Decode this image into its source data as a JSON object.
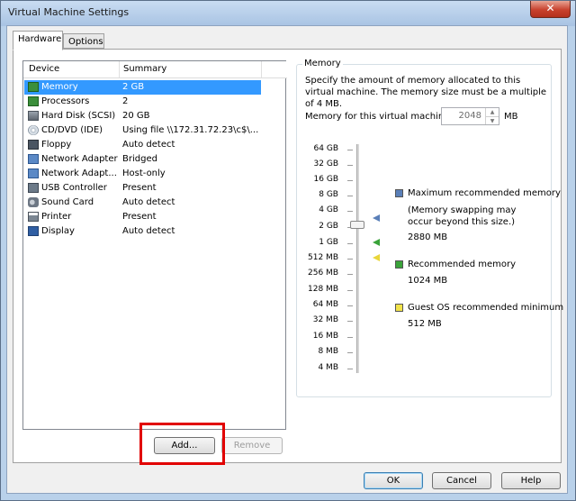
{
  "window": {
    "title": "Virtual Machine Settings",
    "close_glyph": "✕"
  },
  "tabs": [
    {
      "label": "Hardware",
      "active": true
    },
    {
      "label": "Options",
      "active": false
    }
  ],
  "device_list": {
    "columns": [
      "Device",
      "Summary"
    ],
    "rows": [
      {
        "icon": "memory-chip-icon",
        "device": "Memory",
        "summary": "2 GB",
        "selected": true
      },
      {
        "icon": "processor-chip-icon",
        "device": "Processors",
        "summary": "2"
      },
      {
        "icon": "hard-disk-icon",
        "device": "Hard Disk (SCSI)",
        "summary": "20 GB"
      },
      {
        "icon": "cd-dvd-icon",
        "device": "CD/DVD (IDE)",
        "summary": "Using file \\\\172.31.72.23\\c$\\..."
      },
      {
        "icon": "floppy-icon",
        "device": "Floppy",
        "summary": "Auto detect"
      },
      {
        "icon": "network-adapter-icon",
        "device": "Network Adapter",
        "summary": "Bridged"
      },
      {
        "icon": "network-adapter-icon",
        "device": "Network Adapt...",
        "summary": "Host-only"
      },
      {
        "icon": "usb-icon",
        "device": "USB Controller",
        "summary": "Present"
      },
      {
        "icon": "sound-card-icon",
        "device": "Sound Card",
        "summary": "Auto detect"
      },
      {
        "icon": "printer-icon",
        "device": "Printer",
        "summary": "Present"
      },
      {
        "icon": "display-icon",
        "device": "Display",
        "summary": "Auto detect"
      }
    ]
  },
  "list_buttons": {
    "add": "Add...",
    "remove": "Remove"
  },
  "memory": {
    "group_title": "Memory",
    "description": "Specify the amount of memory allocated to this virtual machine. The memory size must be a multiple of 4 MB.",
    "field_label": "Memory for this virtual machine:",
    "field_value": "2048",
    "unit": "MB",
    "scale_labels": [
      "64 GB",
      "32 GB",
      "16 GB",
      "8 GB",
      "4 GB",
      "2 GB",
      "1 GB",
      "512 MB",
      "256 MB",
      "128 MB",
      "64 MB",
      "32 MB",
      "16 MB",
      "8 MB",
      "4 MB"
    ],
    "slider_value": "2 GB",
    "legend": {
      "max_title": "Maximum recommended memory",
      "max_note": "(Memory swapping may occur beyond this size.)",
      "max_value": "2880 MB",
      "rec_title": "Recommended memory",
      "rec_value": "1024 MB",
      "guest_title": "Guest OS recommended minimum",
      "guest_value": "512 MB"
    },
    "colors": {
      "max": "#5a7fb8",
      "recommended": "#3aa33a",
      "guest_min": "#f2e34a"
    }
  },
  "footer_buttons": {
    "ok": "OK",
    "cancel": "Cancel",
    "help": "Help"
  }
}
